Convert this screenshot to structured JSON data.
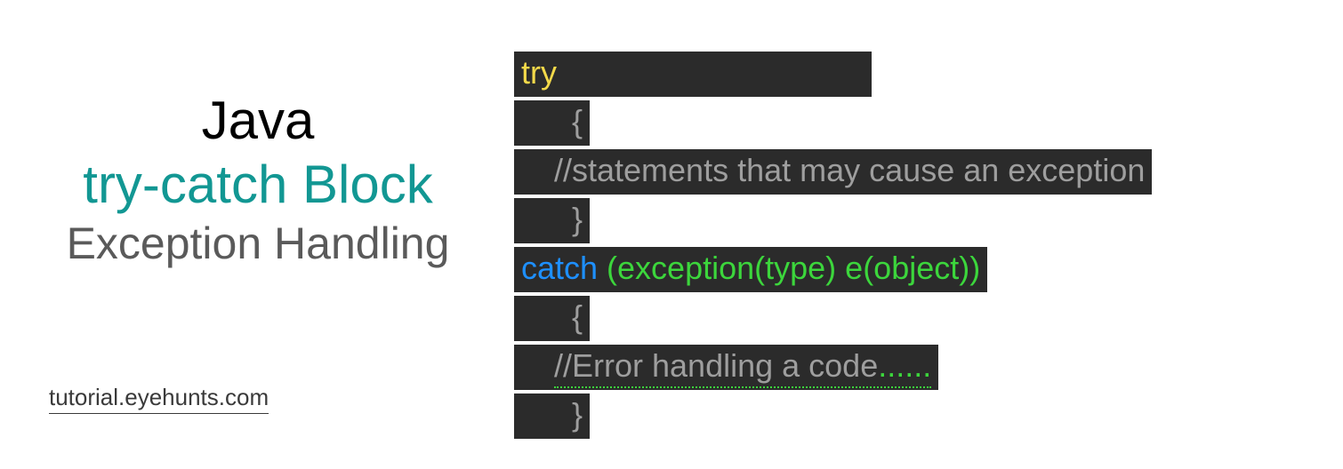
{
  "title": {
    "line1": "Java",
    "line2": "try-catch Block",
    "line3": "Exception Handling"
  },
  "source_url": "tutorial.eyehunts.com",
  "code": {
    "try_kw": "try",
    "open_brace": "{",
    "comment1": "//statements that may cause an exception",
    "close_brace": "}",
    "catch_kw": "catch",
    "catch_params": " (exception(type) e(object))",
    "comment2": "//Error handling a code",
    "dots": "......"
  }
}
